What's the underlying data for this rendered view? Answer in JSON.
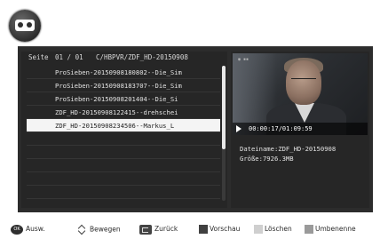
{
  "header": {
    "icon": "video-cassette-icon"
  },
  "list": {
    "page_label": "Seite",
    "page_number": "01 / 01",
    "path": "C/HBPVR/ZDF_HD-20150908",
    "items": [
      {
        "label": "ProSieben-20150908180802--Die_Sim",
        "selected": false
      },
      {
        "label": "ProSieben-20150908183707--Die_Sim",
        "selected": false
      },
      {
        "label": "ProSieben-20150908201404--Die_Si",
        "selected": false
      },
      {
        "label": "ZDF_HD-20150908122415--drehschei",
        "selected": false
      },
      {
        "label": "ZDF_HD-20150908234506--Markus_L",
        "selected": true
      },
      {
        "label": "",
        "selected": false
      },
      {
        "label": "",
        "selected": false
      },
      {
        "label": "",
        "selected": false
      },
      {
        "label": "",
        "selected": false
      },
      {
        "label": "",
        "selected": false
      }
    ],
    "scroll_fraction": 0.62
  },
  "preview": {
    "time": "00:00:17/01:09:59",
    "filename_label": "Dateiname:ZDF_HD-20150908",
    "size_label": "Größe:7926.3MB"
  },
  "footer": {
    "ok_icon_text": "OK",
    "select_label": "Ausw.",
    "move_label": "Bewegen",
    "back_label": "Zurück",
    "preview_label": "Vorschau",
    "delete_label": "Löschen",
    "rename_label": "Umbenenne",
    "key_colors": {
      "preview": "#404040",
      "delete": "#cfcfcf",
      "rename": "#9a9a9a"
    }
  }
}
